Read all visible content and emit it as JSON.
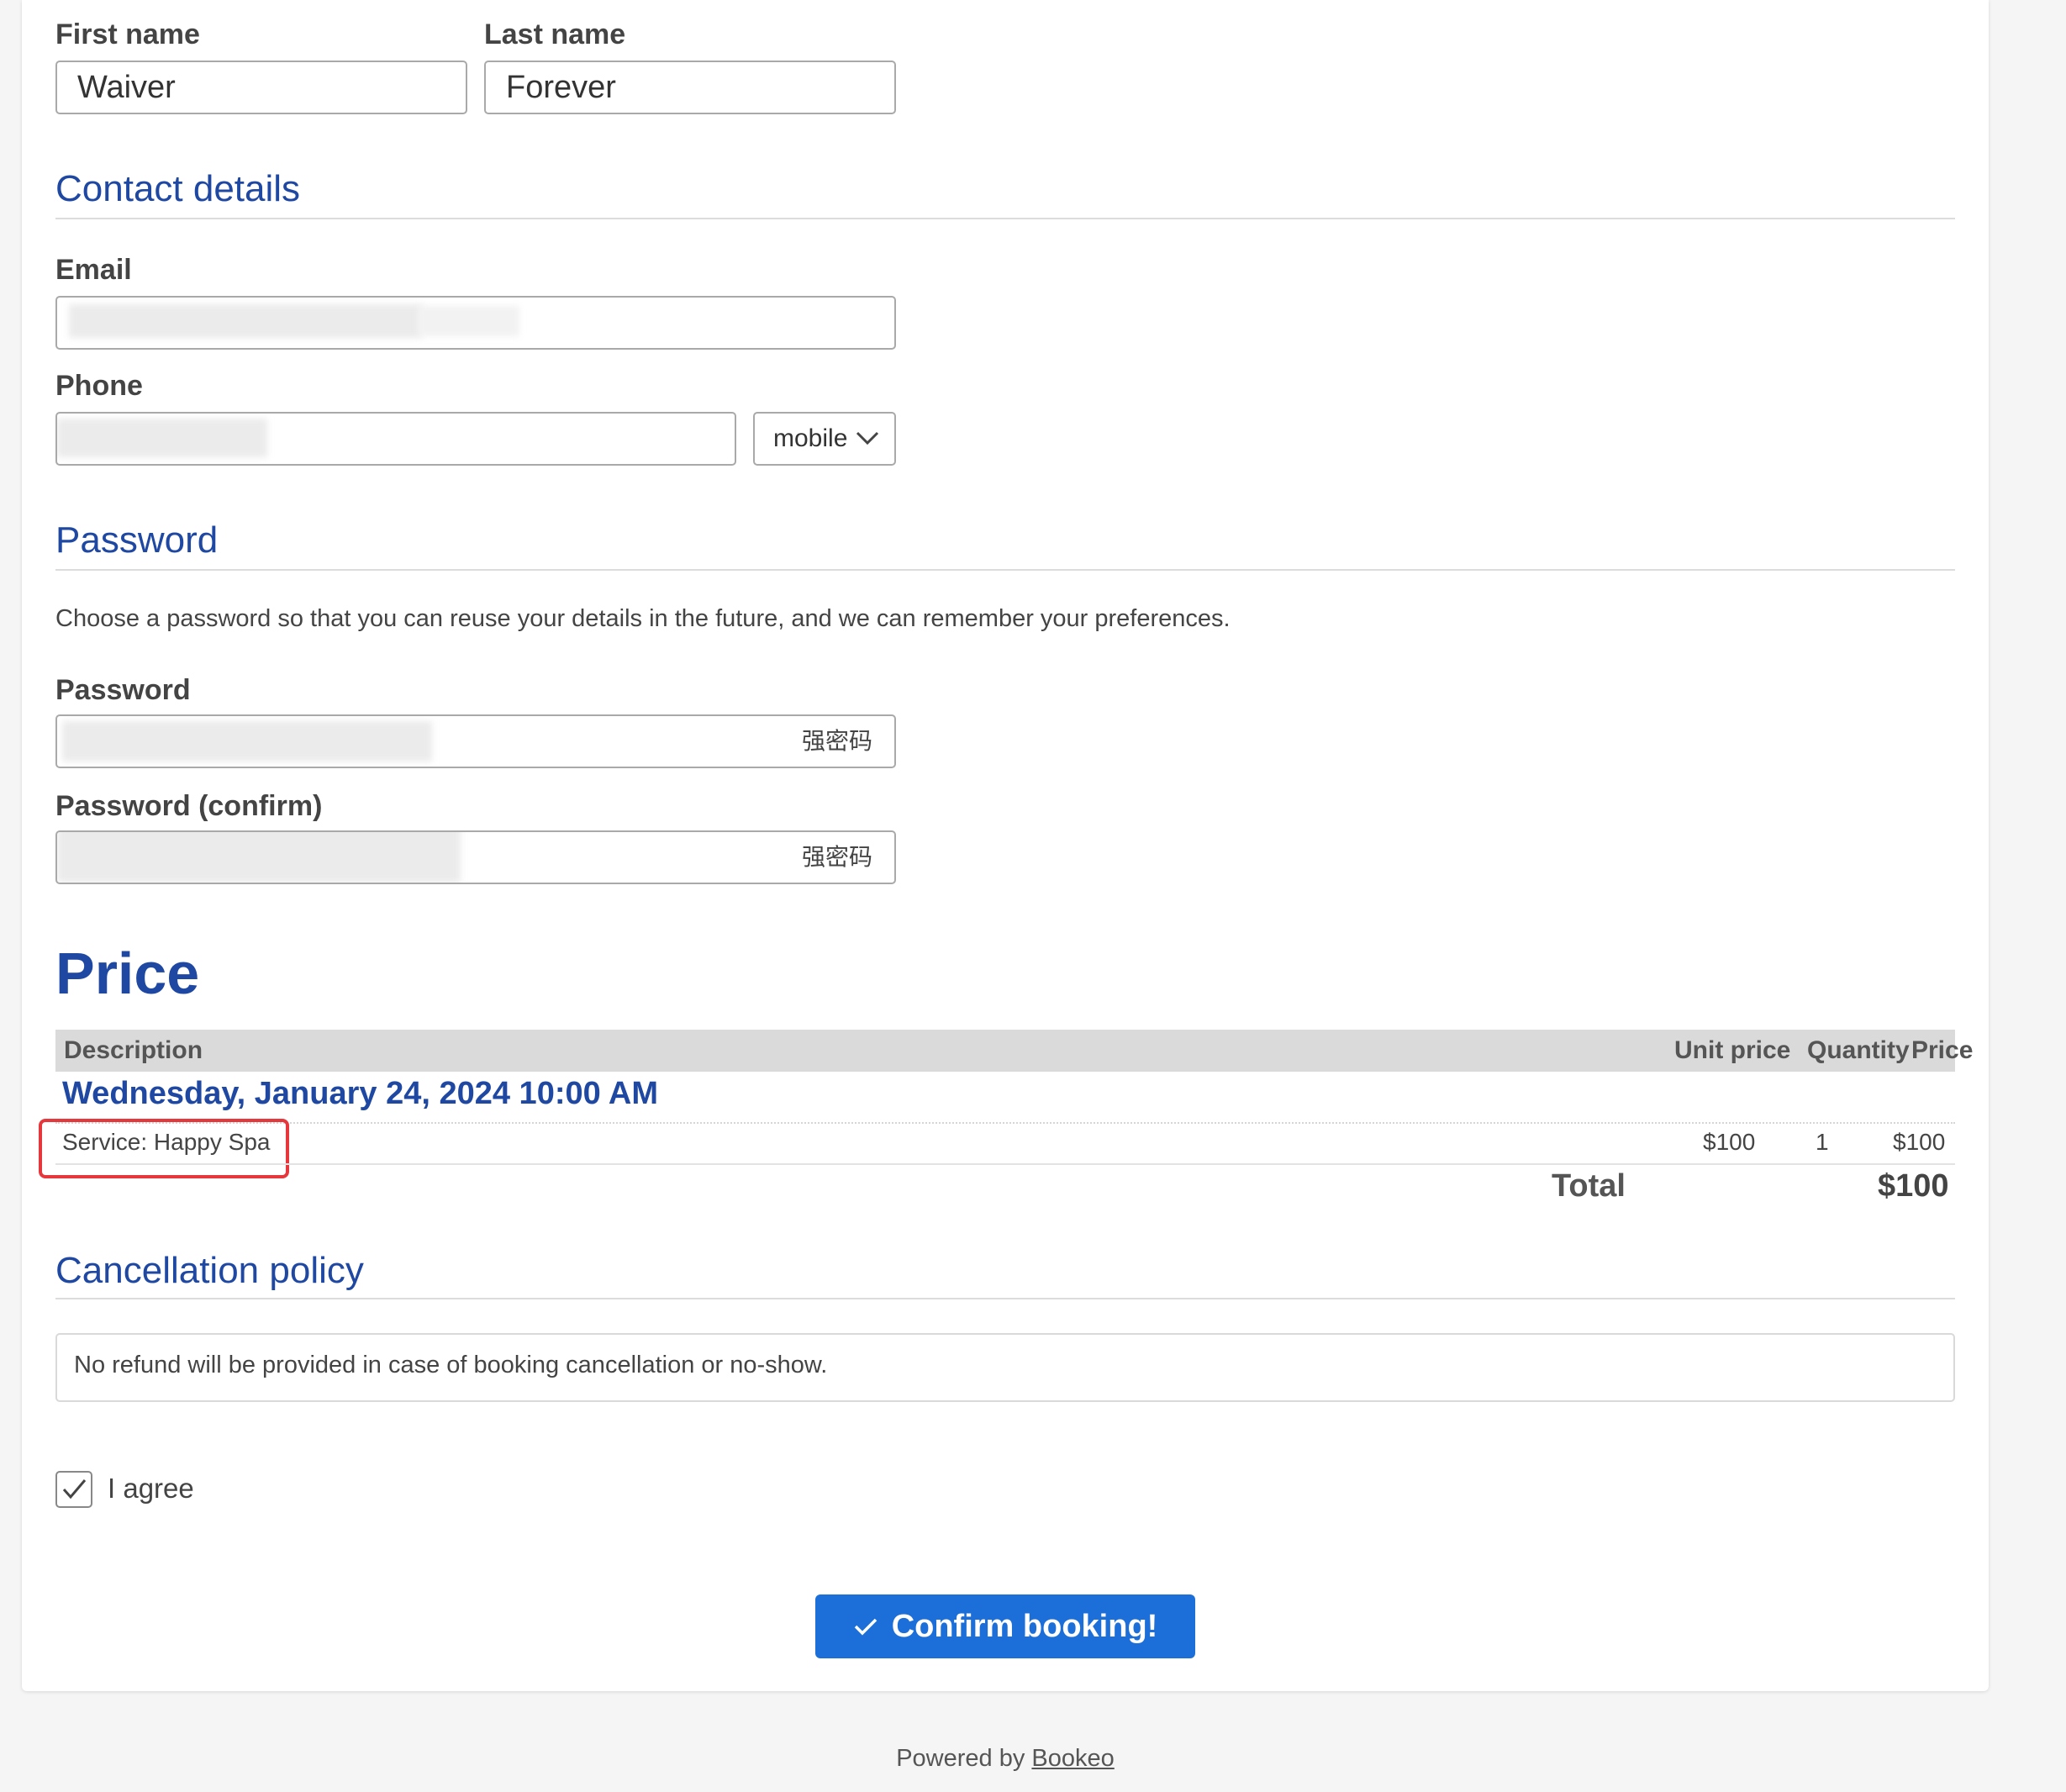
{
  "form": {
    "first_name_label": "First name",
    "first_name_value": "Waiver",
    "last_name_label": "Last name",
    "last_name_value": "Forever"
  },
  "contact": {
    "title": "Contact details",
    "email_label": "Email",
    "phone_label": "Phone",
    "phone_type": "mobile"
  },
  "password": {
    "title": "Password",
    "description": "Choose a password so that you can reuse your details in the future, and we can remember your preferences.",
    "password_label": "Password",
    "confirm_label": "Password (confirm)",
    "strength_text": "强密码"
  },
  "price": {
    "title": "Price",
    "columns": {
      "description": "Description",
      "unit_price": "Unit price",
      "quantity": "Quantity",
      "price": "Price"
    },
    "booking_date": "Wednesday, January 24, 2024 10:00 AM",
    "item": {
      "description": "Service: Happy Spa",
      "unit_price": "$100",
      "quantity": "1",
      "price": "$100"
    },
    "total_label": "Total",
    "total_value": "$100",
    "highlight_color": "#e5373c"
  },
  "cancellation": {
    "title": "Cancellation policy",
    "text": "No refund will be provided in case of booking cancellation or no-show."
  },
  "agree": {
    "label": "I agree",
    "checked": true
  },
  "confirm_button": {
    "label": "Confirm booking!",
    "color": "#1c6fd9"
  },
  "footer": {
    "powered_by": "Powered by",
    "brand": "Bookeo"
  },
  "colors": {
    "accent": "#1f48a3",
    "background": "#f5f5f5"
  }
}
